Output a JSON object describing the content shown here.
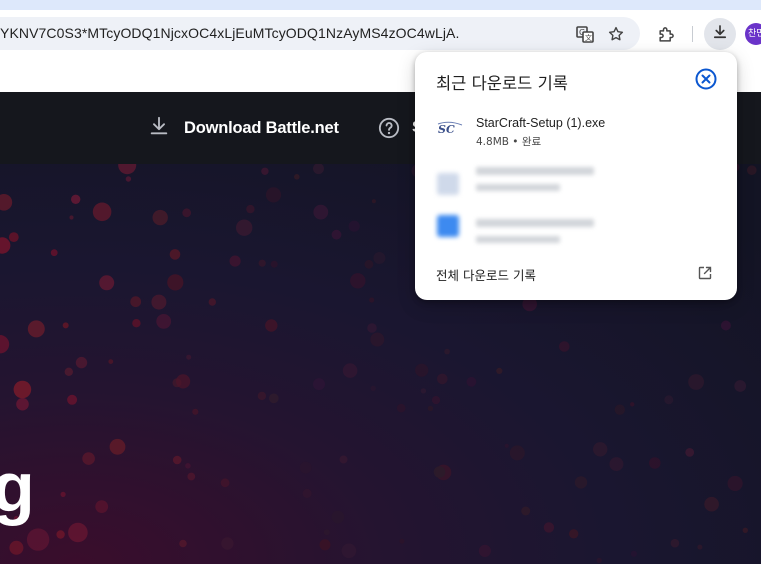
{
  "browser": {
    "url": "YKNV7C0S3*MTcyODQ1NjcxOC4xLjEuMTcyODQ1NzAyMS4zOC4wLjA.",
    "profile_initials": "찬민",
    "icons": [
      "translate-icon",
      "star-icon",
      "extensions-icon",
      "download-icon"
    ]
  },
  "site": {
    "download_label": "Download Battle.net",
    "next_nav_initial": "S",
    "hero_text": "g"
  },
  "downloads": {
    "title": "최근 다운로드 기록",
    "items": [
      {
        "name": "StarCraft-Setup (1).exe",
        "meta": "4.8MB • 완료",
        "icon": "starcraft-file-icon"
      }
    ],
    "footer": "전체 다운로드 기록"
  },
  "colors": {
    "accent": "#0b57d0",
    "header_bg": "#15171d",
    "avatar": "#6a33c9"
  }
}
